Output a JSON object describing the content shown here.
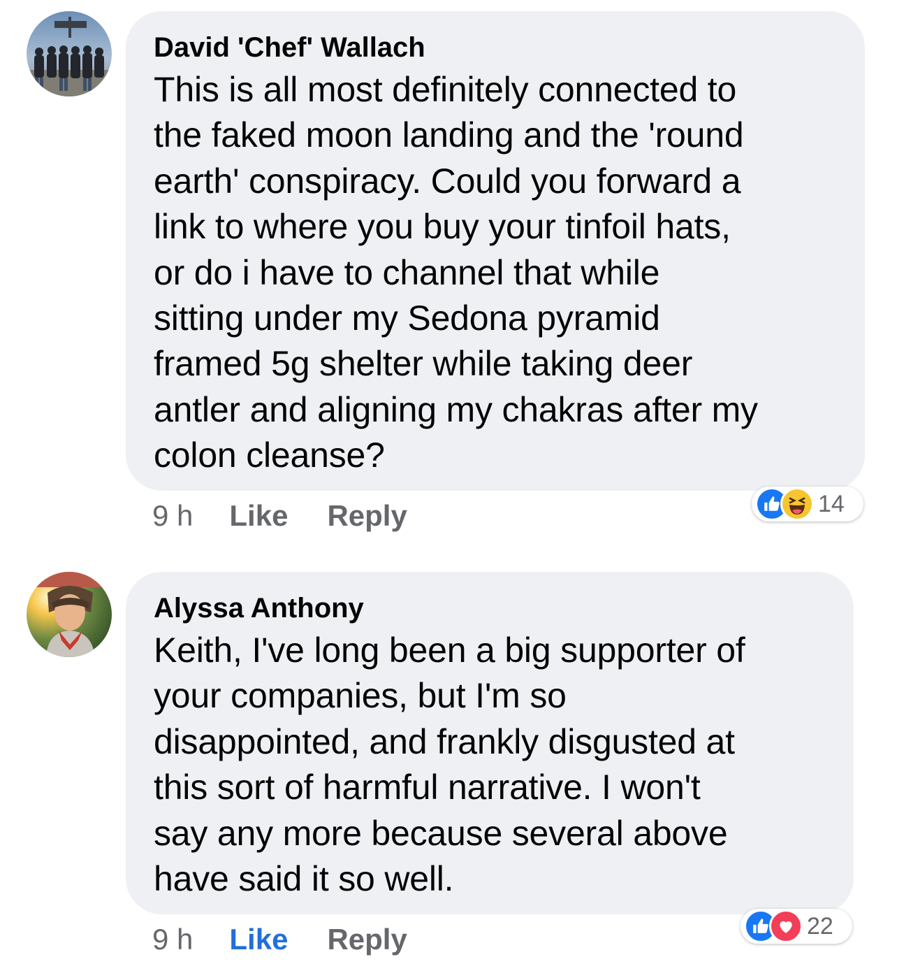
{
  "comments": [
    {
      "author": "David 'Chef' Wallach",
      "text": "This is all most definitely connected to\nthe faked moon landing and the 'round\nearth' conspiracy. Could you forward a\nlink to where you buy your tinfoil hats,\nor do i have to channel that while\nsitting under my Sedona pyramid\nframed 5g shelter while taking deer\nantler and aligning my chakras after my\ncolon cleanse?",
      "time": "9 h",
      "like_label": "Like",
      "reply_label": "Reply",
      "reaction_icons": [
        "like-icon",
        "haha-icon"
      ],
      "reaction_count": "14",
      "liked": false
    },
    {
      "author": "Alyssa Anthony",
      "text": "Keith, I've long been a big supporter of\nyour companies, but I'm so\ndisappointed, and frankly disgusted at\nthis sort of harmful narrative. I won't\nsay any more because several above\nhave said it so well.",
      "time": "9 h",
      "like_label": "Like",
      "reply_label": "Reply",
      "reaction_icons": [
        "like-icon",
        "love-icon"
      ],
      "reaction_count": "22",
      "liked": true
    }
  ],
  "colors": {
    "bubble_bg": "#eff0f3",
    "meta_text": "#65676b",
    "like_active": "#216fdb",
    "like_reaction": "#1877f2",
    "love_reaction": "#f33e58",
    "haha_reaction": "#f7c52f"
  }
}
